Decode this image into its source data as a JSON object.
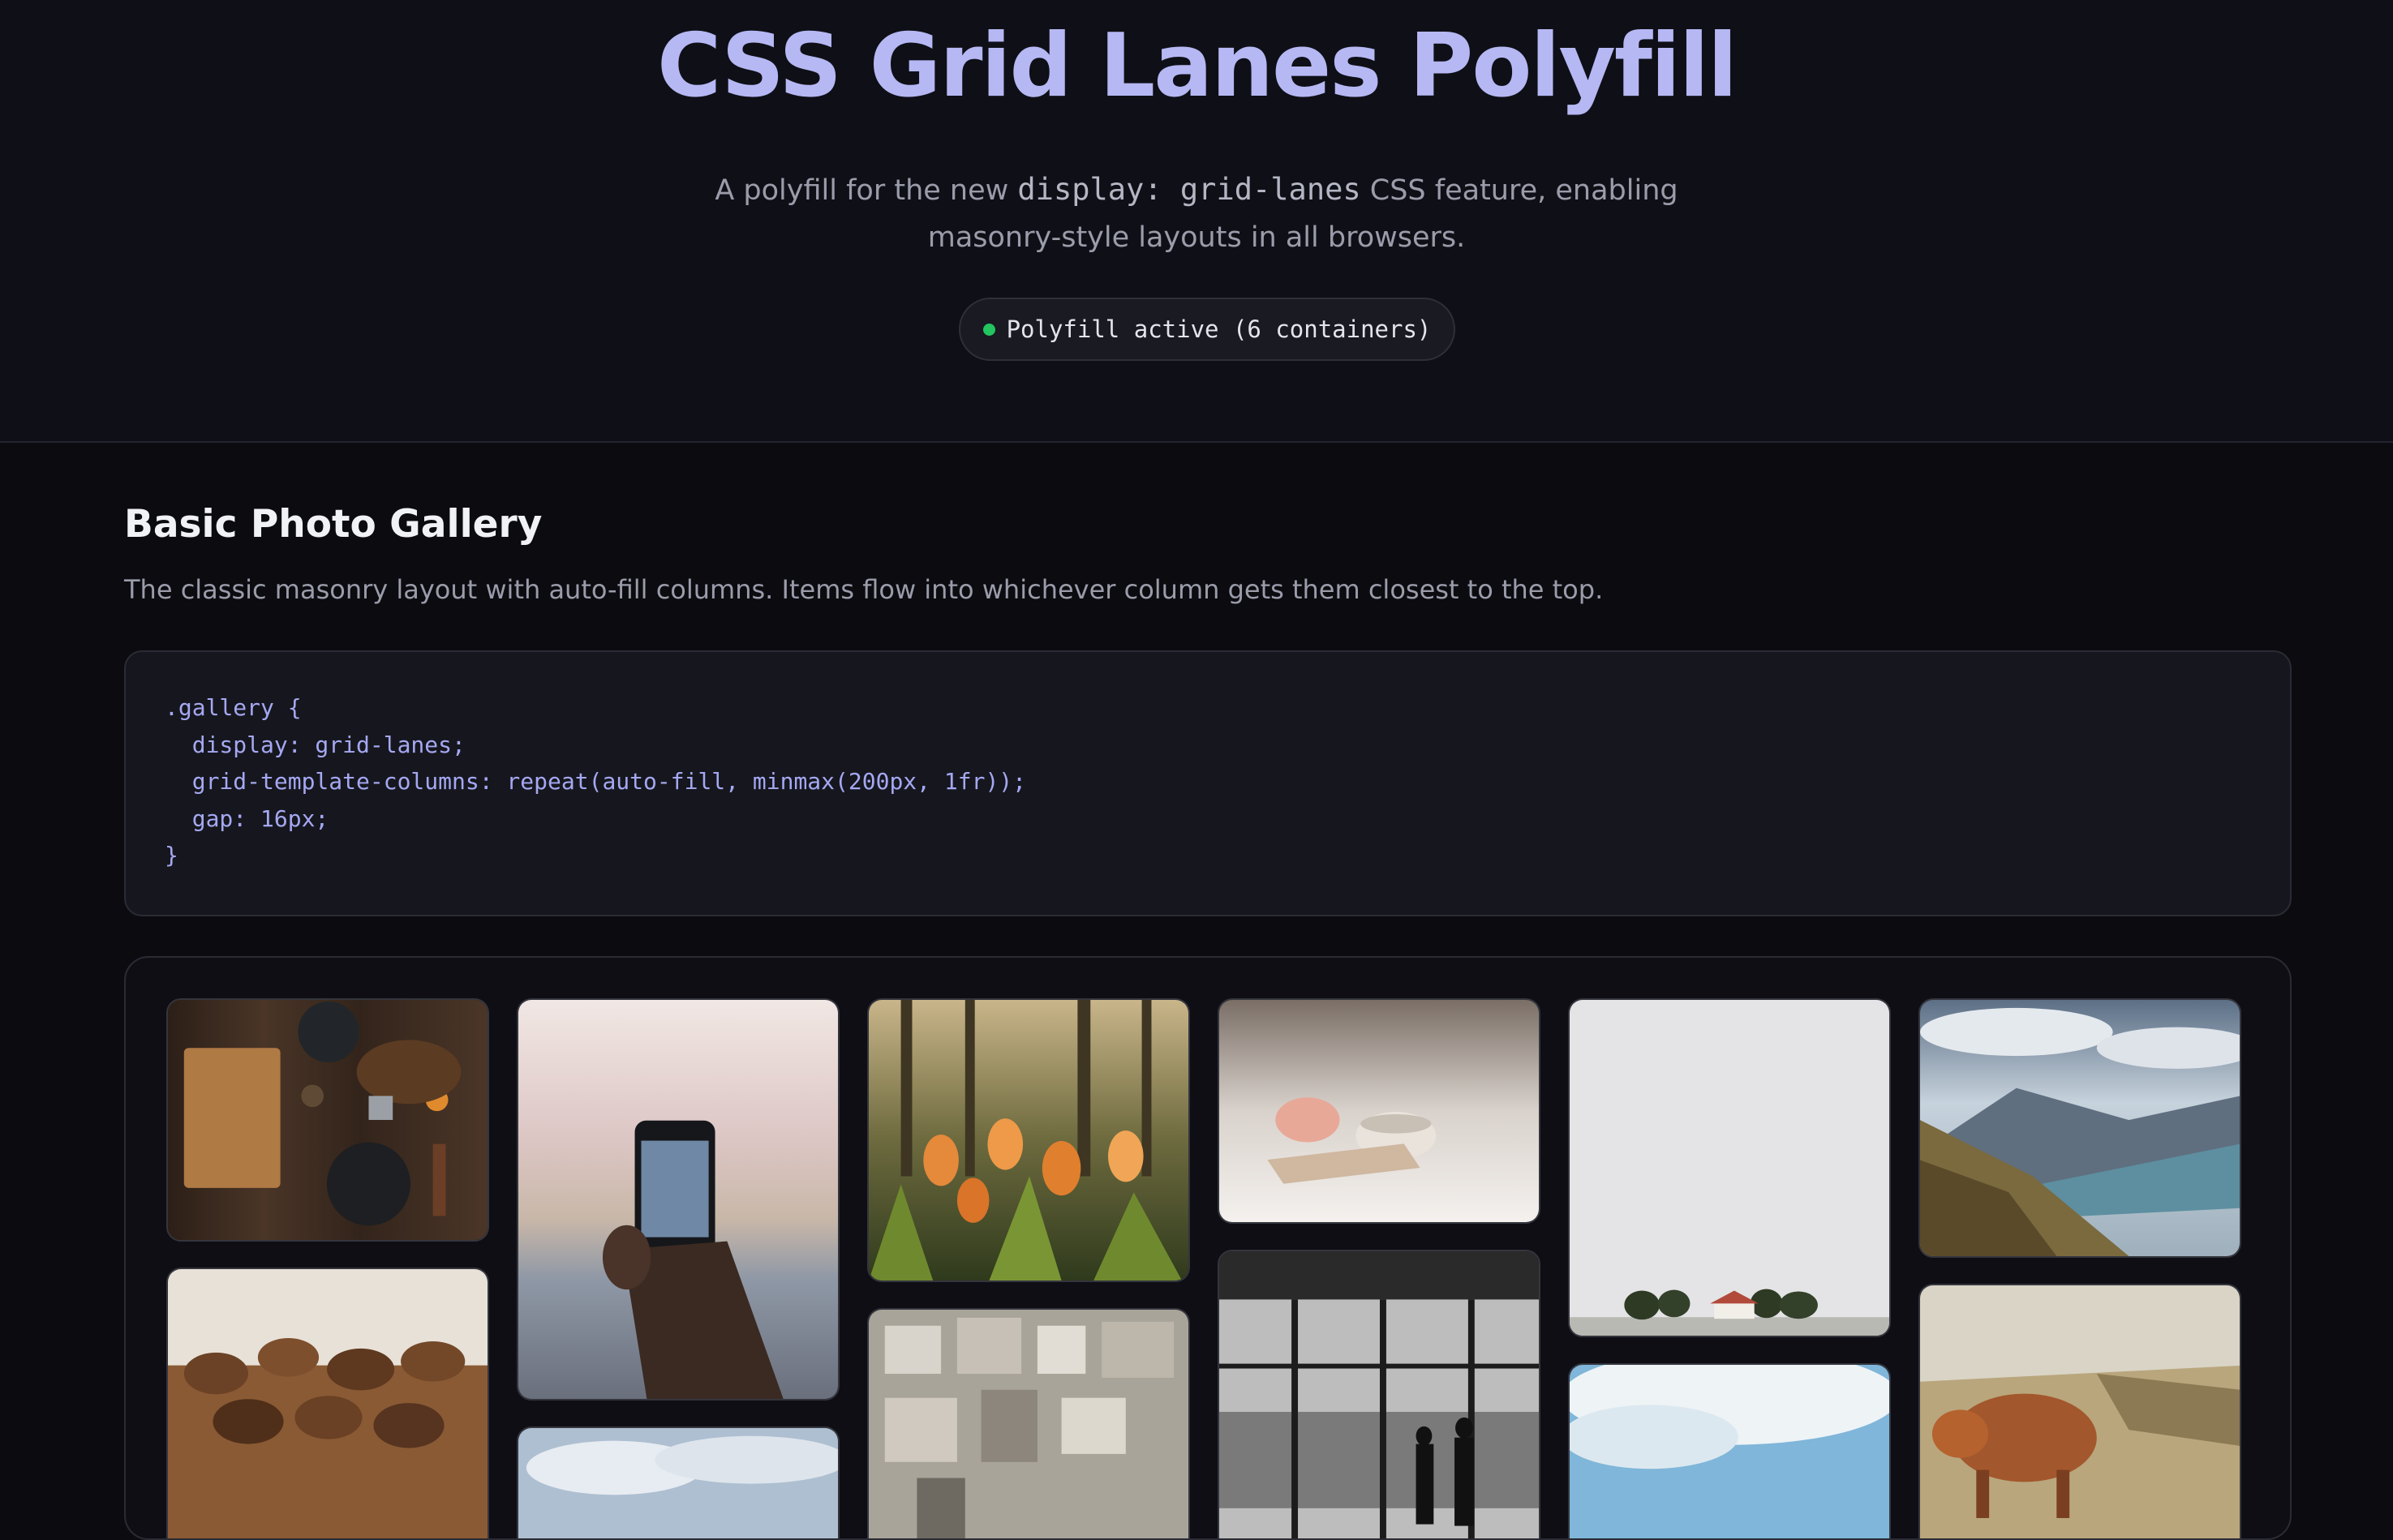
{
  "header": {
    "title": "CSS Grid Lanes Polyfill",
    "subtitle_before": "A polyfill for the new ",
    "subtitle_code": "display: grid-lanes",
    "subtitle_after": " CSS feature, enabling masonry-style layouts in all browsers.",
    "status": {
      "text": "Polyfill active (6 containers)",
      "dot_color": "#22c55e"
    }
  },
  "section": {
    "title": "Basic Photo Gallery",
    "description": "The classic masonry layout with auto-fill columns. Items flow into whichever column gets them closest to the top.",
    "code_lines": [
      ".gallery {",
      "  display: grid-lanes;",
      "  grid-template-columns: repeat(auto-fill, minmax(200px, 1fr));",
      "  gap: 16px;",
      "}"
    ]
  },
  "colors": {
    "title": "#b6b8f4",
    "code": "#a5a8f2",
    "background": "#0b0b10"
  },
  "gallery": {
    "photos": [
      {
        "subject": "kitchen tools on wooden table"
      },
      {
        "subject": "coffee beans"
      },
      {
        "subject": "hand holding phone at sunset"
      },
      {
        "subject": "clouds"
      },
      {
        "subject": "orange tulips in forest"
      },
      {
        "subject": "aerial city buildings"
      },
      {
        "subject": "teacup and flower"
      },
      {
        "subject": "silhouettes at skyscraper window"
      },
      {
        "subject": "white sky with house and trees"
      },
      {
        "subject": "blue sky with clouds"
      },
      {
        "subject": "mountain lake valley"
      },
      {
        "subject": "highland cow"
      }
    ]
  }
}
